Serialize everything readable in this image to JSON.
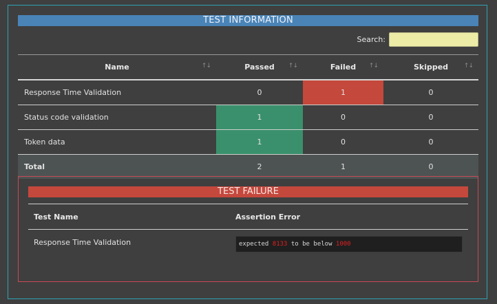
{
  "info": {
    "title": "TEST INFORMATION",
    "search_label": "Search:",
    "search_value": "",
    "columns": {
      "name": "Name",
      "passed": "Passed",
      "failed": "Failed",
      "skipped": "Skipped"
    },
    "sort_glyph": "↑↓",
    "rows": [
      {
        "name": "Response Time Validation",
        "passed": "0",
        "failed": "1",
        "skipped": "0"
      },
      {
        "name": "Status code validation",
        "passed": "1",
        "failed": "0",
        "skipped": "0"
      },
      {
        "name": "Token data",
        "passed": "1",
        "failed": "0",
        "skipped": "0"
      }
    ],
    "total": {
      "name": "Total",
      "passed": "2",
      "failed": "1",
      "skipped": "0"
    }
  },
  "failure": {
    "title": "TEST FAILURE",
    "columns": {
      "test_name": "Test Name",
      "assertion_error": "Assertion Error"
    },
    "rows": [
      {
        "test_name": "Response Time Validation",
        "error_prefix": "expected ",
        "error_actual": "8133",
        "error_middle": " to be below ",
        "error_expected": "1000"
      }
    ]
  },
  "colors": {
    "header_bar": "#4a84b7",
    "failure_bar": "#c5483d",
    "passed_cell": "#3a906c",
    "failed_cell": "#c4483b",
    "frame_border": "#2fa3b5",
    "failure_border": "#c94a58"
  }
}
